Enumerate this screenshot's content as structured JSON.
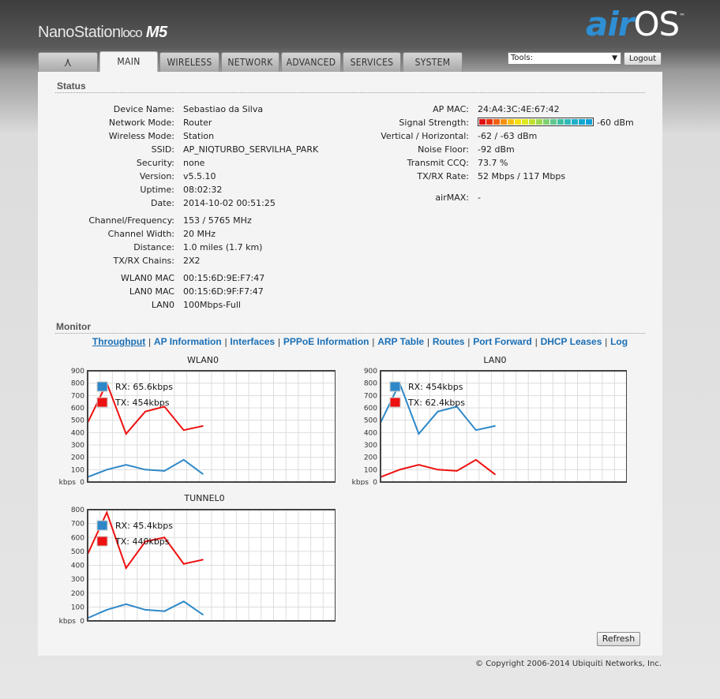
{
  "header": {
    "product": "NanoStation",
    "product_loco": "loco",
    "product_model": "M5",
    "brand_air": "air",
    "brand_os": "OS",
    "brand_tm": "™"
  },
  "tabs": [
    {
      "label": "⋏",
      "name": "logo"
    },
    {
      "label": "MAIN",
      "name": "main",
      "active": true
    },
    {
      "label": "WIRELESS",
      "name": "wireless"
    },
    {
      "label": "NETWORK",
      "name": "network"
    },
    {
      "label": "ADVANCED",
      "name": "advanced"
    },
    {
      "label": "SERVICES",
      "name": "services"
    },
    {
      "label": "SYSTEM",
      "name": "system"
    }
  ],
  "tools": {
    "label": "Tools:",
    "arrow": "▼"
  },
  "logout_label": "Logout",
  "status": {
    "title": "Status",
    "left": [
      {
        "label": "Device Name:",
        "value": "Sebastiao da Silva"
      },
      {
        "label": "Network Mode:",
        "value": "Router"
      },
      {
        "label": "Wireless Mode:",
        "value": "Station"
      },
      {
        "label": "SSID:",
        "value": "AP_NIQTURBO_SERVILHA_PARK"
      },
      {
        "label": "Security:",
        "value": "none"
      },
      {
        "label": "Version:",
        "value": "v5.5.10"
      },
      {
        "label": "Uptime:",
        "value": "08:02:32"
      },
      {
        "label": "Date:",
        "value": "2014-10-02 00:51:25"
      },
      {
        "label": "Channel/Frequency:",
        "value": "153 / 5765 MHz"
      },
      {
        "label": "Channel Width:",
        "value": "20 MHz"
      },
      {
        "label": "Distance:",
        "value": "1.0 miles (1.7 km)"
      },
      {
        "label": "TX/RX Chains:",
        "value": "2X2"
      },
      {
        "label": "WLAN0 MAC",
        "value": "00:15:6D:9E:F7:47"
      },
      {
        "label": "LAN0 MAC",
        "value": "00:15:6D:9F:F7:47"
      },
      {
        "label": "LAN0",
        "value": "100Mbps-Full"
      }
    ],
    "right": [
      {
        "label": "AP MAC:",
        "value": "24:A4:3C:4E:67:42"
      },
      {
        "label": "Signal Strength:",
        "value": "-60 dBm"
      },
      {
        "label": "Vertical / Horizontal:",
        "value": "-62 / -63 dBm"
      },
      {
        "label": "Noise Floor:",
        "value": "-92 dBm"
      },
      {
        "label": "Transmit CCQ:",
        "value": "73.7 %"
      },
      {
        "label": "TX/RX Rate:",
        "value": "52 Mbps / 117 Mbps"
      },
      {
        "label": "airMAX:",
        "value": "-"
      }
    ],
    "signal_level": 1.0,
    "signal_colors": [
      "#e01010",
      "#e83010",
      "#f06010",
      "#f49010",
      "#f8c010",
      "#f8e010",
      "#e0e820",
      "#c0e030",
      "#a0d850",
      "#80d070",
      "#60c890",
      "#40c0a0",
      "#30b8b8",
      "#20b0c8",
      "#10a8d0",
      "#10a0d8"
    ]
  },
  "monitor": {
    "title": "Monitor",
    "links": [
      {
        "label": "Throughput",
        "current": true
      },
      {
        "label": "AP Information"
      },
      {
        "label": "Interfaces"
      },
      {
        "label": "PPPoE Information"
      },
      {
        "label": "ARP Table"
      },
      {
        "label": "Routes"
      },
      {
        "label": "Port Forward"
      },
      {
        "label": "DHCP Leases"
      },
      {
        "label": "Log"
      }
    ],
    "separator": "|"
  },
  "chart_data": [
    {
      "type": "line",
      "title": "WLAN0",
      "ylabel": "kbps",
      "yticks": [
        0,
        100,
        200,
        300,
        400,
        500,
        600,
        700,
        800,
        900
      ],
      "ylim": [
        0,
        900
      ],
      "x": [
        0,
        1,
        2,
        3,
        4,
        5,
        6
      ],
      "series": [
        {
          "name": "RX: 65.6kbps",
          "color": "#2e88c8",
          "values": [
            40,
            100,
            140,
            100,
            90,
            180,
            65
          ]
        },
        {
          "name": "TX: 454kbps",
          "color": "#ee1111",
          "values": [
            480,
            800,
            390,
            570,
            610,
            420,
            454
          ]
        }
      ]
    },
    {
      "type": "line",
      "title": "LAN0",
      "ylabel": "kbps",
      "yticks": [
        0,
        100,
        200,
        300,
        400,
        500,
        600,
        700,
        800,
        900
      ],
      "ylim": [
        0,
        900
      ],
      "x": [
        0,
        1,
        2,
        3,
        4,
        5,
        6
      ],
      "series": [
        {
          "name": "RX: 454kbps",
          "color": "#2e88c8",
          "values": [
            480,
            800,
            390,
            570,
            610,
            420,
            454
          ]
        },
        {
          "name": "TX: 62.4kbps",
          "color": "#ee1111",
          "values": [
            40,
            100,
            140,
            100,
            90,
            180,
            62
          ]
        }
      ]
    },
    {
      "type": "line",
      "title": "TUNNEL0",
      "ylabel": "kbps",
      "yticks": [
        0,
        100,
        200,
        300,
        400,
        500,
        600,
        700,
        800
      ],
      "ylim": [
        0,
        800
      ],
      "x": [
        0,
        1,
        2,
        3,
        4,
        5,
        6
      ],
      "series": [
        {
          "name": "RX: 45.4kbps",
          "color": "#2e88c8",
          "values": [
            20,
            80,
            120,
            80,
            70,
            140,
            45
          ]
        },
        {
          "name": "TX: 440kbps",
          "color": "#ee1111",
          "values": [
            480,
            780,
            380,
            570,
            600,
            410,
            440
          ]
        }
      ]
    }
  ],
  "refresh_label": "Refresh",
  "copyright": "© Copyright 2006-2014 Ubiquiti Networks, Inc."
}
